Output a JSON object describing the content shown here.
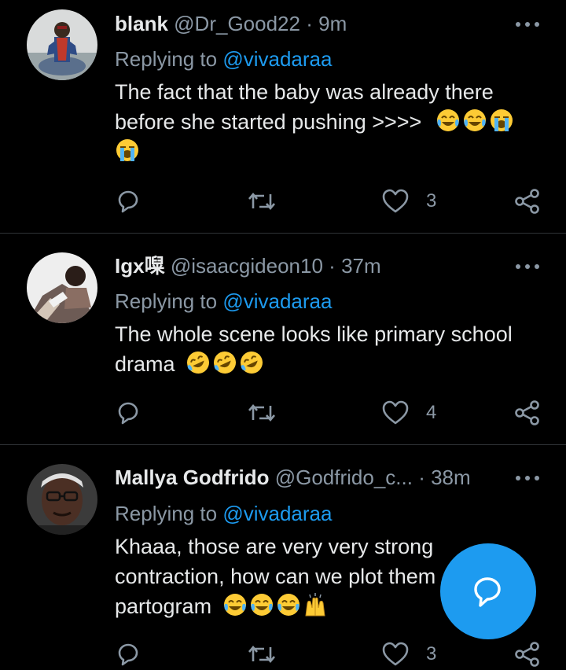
{
  "tweets": [
    {
      "name": "blank",
      "handle": "@Dr_Good22",
      "dot": "·",
      "time": "9m",
      "replying_prefix": "Replying to ",
      "replying_to": "@vivadaraa",
      "line1": "The fact that the baby was already there",
      "line2": "before she started pushing >>>>",
      "emojis_line2": [
        "face-with-tears-of-joy",
        "face-with-tears-of-joy",
        "loudly-crying-face"
      ],
      "emojis_line3": [
        "loudly-crying-face"
      ],
      "reply_count": "",
      "retweet_count": "",
      "like_count": "3"
    },
    {
      "name": "Igx",
      "name_suffix": "㘀",
      "handle": "@isaacgideon10",
      "dot": "·",
      "time": "37m",
      "replying_prefix": "Replying to ",
      "replying_to": "@vivadaraa",
      "line1": "The whole scene looks like primary school",
      "line2": "drama",
      "emojis_line2": [
        "rolling-on-floor-laughing",
        "rolling-on-floor-laughing",
        "rolling-on-floor-laughing"
      ],
      "reply_count": "",
      "retweet_count": "",
      "like_count": "4"
    },
    {
      "name": "Mallya Godfrido",
      "handle": "@Godfrido_c...",
      "dot": "·",
      "time": "38m",
      "replying_prefix": "Replying to ",
      "replying_to": "@vivadaraa",
      "line1": "Khaaa, those are very very strong",
      "line2": "contraction, how can we plot them",
      "line3": "partogram",
      "emojis_line3": [
        "face-with-tears-of-joy",
        "face-with-tears-of-joy",
        "face-with-tears-of-joy",
        "raising-hands"
      ],
      "reply_count": "",
      "retweet_count": "",
      "like_count": "3"
    }
  ],
  "icons": {
    "more": "more-horizontal-icon",
    "reply": "reply-bubble-icon",
    "retweet": "retweet-icon",
    "like": "heart-icon",
    "share": "share-icon",
    "compose": "compose-reply-icon"
  },
  "colors": {
    "background": "#000000",
    "text": "#e7e9ea",
    "secondary": "#8b98a5",
    "accent": "#1d9bf0",
    "divider": "#2f3336"
  }
}
